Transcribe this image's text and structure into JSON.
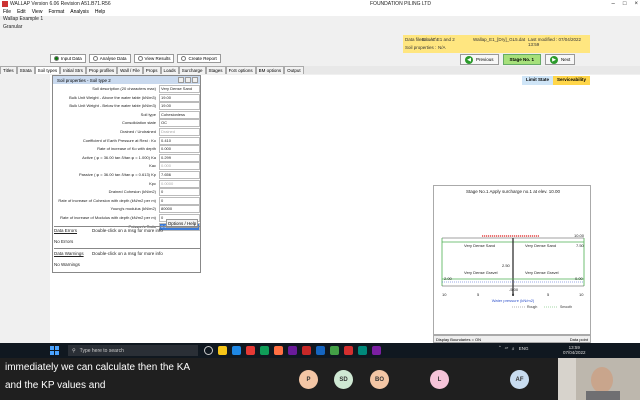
{
  "window": {
    "title": "WALLAP   Version 6.06  Revision A51.B71.R56",
    "company": "FOUNDATION PILING LTD",
    "subtitle": "Wallap Example 1",
    "subtitle2": "Granular"
  },
  "menu": [
    "File",
    "Edit",
    "View",
    "Format",
    "Analysis",
    "Help"
  ],
  "info": {
    "data_filename_label": "Data filename :",
    "data_filename_path": "E:\\...\\E\\E1 and 2",
    "data_filename_value": "Wallap_E1_[Dry]_GL5.dat",
    "last_modified": "Last modified : 07/04/2022 13:59",
    "soil_properties_label": "Soil properties :",
    "soil_properties_value": "N/A"
  },
  "toolbar": {
    "input_data": "Input Data",
    "analyse_data": "Analyse Data",
    "view_results": "View Results",
    "create_report": "Create Report",
    "previous": "Previous",
    "stage": "Stage No.  1",
    "next": "Next"
  },
  "tabs": [
    "Titles",
    "Strata",
    "Soil types",
    "Initial Strs",
    "Prop profiles",
    "Wall / File",
    "Props",
    "Loads",
    "Surcharge",
    "Stages",
    "FoS options",
    "BM options",
    "Output"
  ],
  "limit_state": "Limit State",
  "serviceability": "Serviceability",
  "panel": {
    "title": "Soil properties  -  Soil type 2",
    "props": [
      {
        "label": "Soil description (20 characters max)",
        "value": "Very Dense Sand",
        "state": "normal"
      },
      {
        "label": "Bulk Unit Weight - Above the water table (kN/m3)",
        "value": "19.00",
        "state": "normal"
      },
      {
        "label": "Bulk Unit Weight - Below the water table (kN/m3)",
        "value": "19.00",
        "state": "normal"
      },
      {
        "label": "Soil type",
        "value": "Cohesionless",
        "state": "normal"
      },
      {
        "label": "Consolidation state",
        "value": "OC",
        "state": "normal"
      },
      {
        "label": "Drained / Undrained",
        "value": "Drained",
        "state": "dim"
      },
      {
        "label": "Coefficient of Earth Pressure at Rest : Ko",
        "value": "0.410",
        "state": "normal"
      },
      {
        "label": "Rate of increase of Ko with depth",
        "value": "0.000",
        "state": "normal"
      },
      {
        "label": "Active ( φ = 36.00  tan δ/tan φ = 1.000)  Ka",
        "value": "0.299",
        "state": "normal"
      },
      {
        "label": "Kac",
        "value": "0.000",
        "state": "dim"
      },
      {
        "label": "Passive ( φ = 36.00  tan δ/tan φ = 0.613)  Kp",
        "value": "7.656",
        "state": "normal"
      },
      {
        "label": "Kpc",
        "value": "0.0000",
        "state": "dim"
      },
      {
        "label": "Drained Cohesion (kN/m2)",
        "value": "0",
        "state": "normal"
      },
      {
        "label": "Rate of increase of Cohesion with depth (kN/m2 per m)",
        "value": "0",
        "state": "normal"
      },
      {
        "label": "Young's modulus (kN/m2)",
        "value": "80000",
        "state": "normal"
      },
      {
        "label": "Rate of increase of Modulus with depth (kN/m2 per m)",
        "value": "0",
        "state": "normal"
      },
      {
        "label": "Poisson's Ratio",
        "value": "0.240",
        "state": "selected"
      }
    ],
    "options_help": "Options / Help"
  },
  "errors": {
    "title": "Data Errors",
    "hint": "Double-click on a msg for more info",
    "msg": "No Errors"
  },
  "warnings": {
    "title": "Data Warnings",
    "hint": "Double-click on a msg for more info",
    "msg": "No Warnings"
  },
  "chart": {
    "title": "Stage No.1   Apply surcharge no.1 at elev. 10.00",
    "soil_left_top": "Very Dense Sand",
    "soil_right_top": "Very Dense Sand",
    "soil_left_bottom": "Very Dense Gravel",
    "soil_right_bottom": "Very Dense Gravel",
    "elev_top": "10.00",
    "elev_right": "7.50",
    "elev_mid": "2.50",
    "elev_left_low": "2.00",
    "elev_right_low": "0.00",
    "elev_bottom": "-5.00",
    "x_ticks": [
      "10",
      "5",
      "0",
      "5",
      "10"
    ],
    "legend": "Water pressure (kN/m2)",
    "legend_rough": "Rough",
    "legend_smooth": "Smooth"
  },
  "statusbar": {
    "left": "Display Boundaries = ON",
    "right": "Data point"
  },
  "taskbar": {
    "search": "Type here to search",
    "lang": "ENG",
    "time": "13:59",
    "date": "07/04/2022"
  },
  "captions": [
    "immediately we can calculate then the KA",
    "and the KP values and"
  ],
  "participants": [
    {
      "initials": "P",
      "color": "#f3c6a5"
    },
    {
      "initials": "SD",
      "color": "#cfe8d3"
    },
    {
      "initials": "BO",
      "color": "#f3c6a5"
    },
    {
      "initials": "L",
      "color": "#f6c4d9"
    },
    {
      "initials": "AF",
      "color": "#c8dcf0"
    }
  ]
}
